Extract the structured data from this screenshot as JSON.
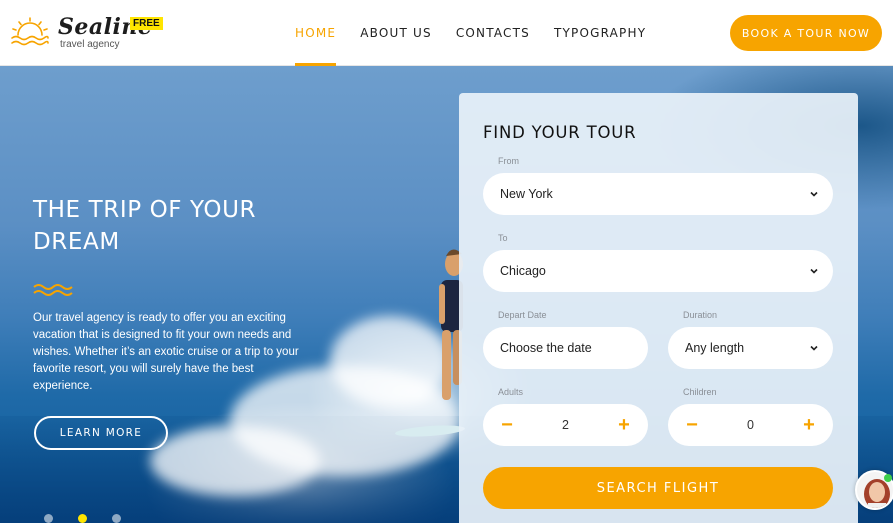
{
  "header": {
    "logo": {
      "name": "Sealine",
      "badge": "FREE",
      "tagline": "travel agency"
    },
    "nav": [
      {
        "label": "HOME",
        "active": true
      },
      {
        "label": "ABOUT US",
        "active": false
      },
      {
        "label": "CONTACTS",
        "active": false
      },
      {
        "label": "TYPOGRAPHY",
        "active": false
      }
    ],
    "cta_label": "BOOK A TOUR NOW"
  },
  "hero": {
    "title": "THE TRIP OF YOUR DREAM",
    "description": "Our travel agency is ready to offer you an exciting vacation that is designed to fit your own needs and wishes. Whether it’s an exotic cruise or a trip to your favorite resort, you will surely have the best experience.",
    "button_label": "LEARN MORE",
    "slides": {
      "count": 3,
      "active": 2
    }
  },
  "tour_form": {
    "title": "FIND YOUR TOUR",
    "from": {
      "label": "From",
      "value": "New York"
    },
    "to": {
      "label": "To",
      "value": "Chicago"
    },
    "depart": {
      "label": "Depart Date",
      "value": "Choose the date"
    },
    "duration": {
      "label": "Duration",
      "value": "Any length"
    },
    "adults": {
      "label": "Adults",
      "value": "2"
    },
    "children": {
      "label": "Children",
      "value": "0"
    },
    "stepper_minus": "−",
    "stepper_plus": "+",
    "submit_label": "SEARCH FLIGHT"
  },
  "colors": {
    "accent": "#f7a400",
    "badge": "#ffe500",
    "panel": "#e8f1f9"
  },
  "icons": {
    "logo": "sun-over-waves-icon",
    "select": "chevron-down-icon",
    "hero_divider": "wave-icon",
    "chat": "support-avatar"
  }
}
